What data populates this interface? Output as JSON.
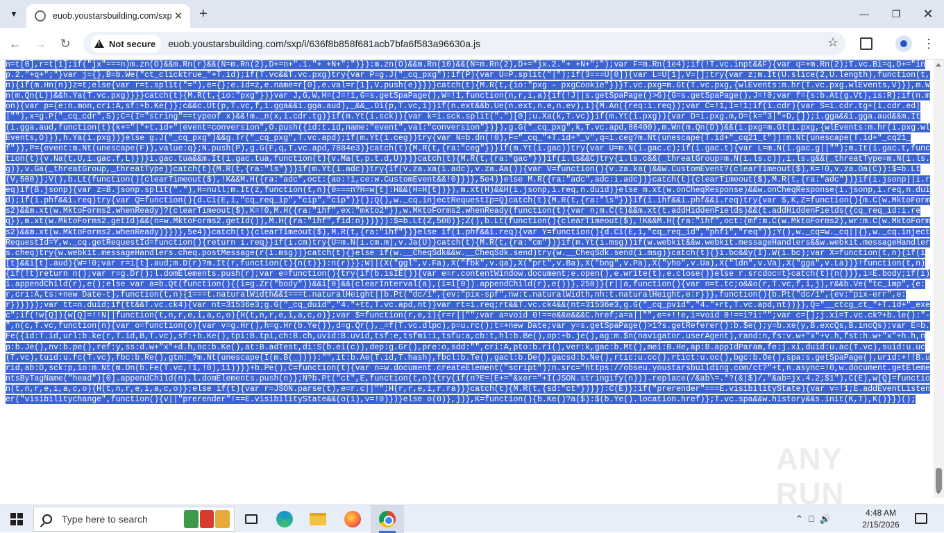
{
  "browser": {
    "tab_title": "euob.youstarsbuilding.com/sxp",
    "security_label": "Not secure",
    "url": "euob.youstarsbuilding.com/sxp/i/636f8b858f681acb7bfa6f583a96630a.js",
    "icons": [
      "tab-search-icon",
      "favicon-icon",
      "close-icon",
      "plus-icon",
      "minimize-icon",
      "maximize-icon",
      "close-window-icon",
      "back-icon",
      "forward-icon",
      "reload-icon",
      "warning-icon",
      "star-icon",
      "extensions-icon",
      "profile-icon",
      "kebab-menu-icon"
    ]
  },
  "content": {
    "code": "n=t[0],r=t[1];if(\"jx\"===n)m.zn(O)&&m.Rn(r)&&(N=m.Rn(2),D+=n+\".1.\"+ +N+\";\")}):m.zn(O)&&m.Rn(10)&&(N=m.Rn(2),D+=\"jx.2.\"+ +N+\";\");var F=m.Rn(1e4);if(!T.vc.inpt&&F){var q=+m.Rn(2);T.vc.Bi=q,D+=\"inp.2.\"+q+\";\"}var j={},B=b.We(\"ct_clicktrue_\"+T.id);if(T.vc&&T.vc.pxg)try{var P=g.J(\"_cq_pxg\");if(P){var U=P.split(\"|\");if(3===U[0]){var L=U[1],V=[];try{var z;m.It(U.slice(2,U.length),function(t,n){if(m.Hn(n))z=t;else{var r=t.split(\"=\"),e={};e.id=z,e.name=r[0],e.val=r[1],V.push(e)}})}catch(t){M.R(t,{io:\"pxg - pxgCookie\"})}T.vc.pxg=m.Gt(T.vc.pxg,{wlEvents:m.hr(T.vc.pxg.wlEvents,V)}),m.Wn(m.Qn(L))&&h.Ya(T.vc.pxg)}}}catch(t){M.R(t,{io:\"pxg\"})}var J,G,W,H=(J=!1,G=s.getSpaPage(),W=!1,function(n,r,i,a){if(!J||s.getSpaPage()>G){G=s.getSpaPage(),J=!0;var f={s:b.At(g.Vt),is:R};if(n.mon){var p={e:n.mon,cri:A,sf:+b.Ke()};c&&c.Ut(p,T.vc,f,i.gga&&i.gga.aud),_&&_.Di(p,T.vc,i)}if(n.ext&&b.Ue(n.ext,n.e,n.ev),i){M.An({req:i.req});var C=!1,I=!1;if(i.cdr){var S=i.cdr.tg+(i.cdr.ed||\"\"),x=g.P(\"_cq_cdr\",S);C=(I=\"string\"==typeof x)&&!m._n(x,i.cdr.tg)}if(m.Yt(i.sck)){var k=i.sck.split(\".\")[0];u.Xa(k,T.vc)}if(m.Yt(i.pxg)){var D=i.pxg.m,O=(k=\"3|\"+D,[]);i.gga&&i.gga.aud&&m.It(i.gga.aud,function(t){k+=\"|\"+t.id+\"|event=conversion\",O.push({id:t.id,name:\"event\",val:\"conversion\"})}),g.G(\"_cq_pxg\",k,T.vc.apd,86400),m.Wn(m.Qn(D))&&(i.pxg=m.Gt(i.pxg,{wlEvents:m.hr(i.pxg.wlEvents,O)}),h.Ya(i.pxg))}else g.J(\"_cq_pxg\")&&g.Tr(\"_cq_pxg\",T.vc.apd);if(m.Yt(i.ceg))try{var N=b.dn(!0),F=\"_cq_\"+T.id+\"_v\",q=i.ceg?m.Nt(unescape(T.id+\"_cq21_t\")):m.Nt(unescape(T.id+\"_cq21_f\")),P={event:m.Nt(unescape(F)),value:q};N.push(P),g.G(F,q,T.vc.apd,7884e3)}catch(t){M.R(t,{ra:\"ceg\"})}if(m.Yt(i.gac))try{var U=m.N(i.gac.c);if(i.gac.t){var L=m.N(i.gac.g||\"\");m.It(i.gac.t,function(t){v.Na(t,U,i.gac.f,L)})}i.gac.tua&&m.It(i.gac.tua,function(t){v.Ma(t,p.t.d,U)})}catch(t){M.R(t,{ra:\"gac\"})}if(i.ls&&C)try{i.ls.c&&(_threatGroup=m.N(i.ls.c)),i.ls.g&&(_threatType=m.N(i.ls.g)),v.Ga(_threatGroup,_threatType)}catch(t){M.R(t,{ra:\"ls\"})}if(m.Yt(i.adc))try{if(v.za.xa(i.adc),v.za.Aa()){var V=function(){v.za.ka()&&w.CustomEvent?(clearTimeout($),K=!0,v.za.Oa(C)):$=b.Lt(V,500)};V(),b.Lt(function(){clearTimeout($),!K&&M.H({ra:\"adc\",oct:{ao:!1,ce:w.CustomEvent&&!0}})},5e4)}else M.R({ra:\"adc\",adc:i.adc})}catch(t){clearTimeout($),M.R(t,{ra:\"adc\"})}if(i.jsonp||i.req)if(B.jsonp){var z=B.jsonp.split(\".\"),H=null;m.It(z,function(t,n){0===n?H=w[t]:H&&(H=H[t])}),m.xt(H)&&H(i.jsonp,i.req,n.duid)}else m.xt(w.onCheqResponse)&&w.onCheqResponse(i.jsonp,i.req,n.duid);if(i.phf&&i.req)try{var Q=function(){d.Ci(E,i,\"cq_req_ip\",\"cip\",\"cip\")}();Q(),w._cq.injectRequestIp=Q}catch(t){M.R(t,{ra:\"ls\"})}if(i.ihf&&i.phf&&i.req)try{var $,K,Z=function(){m.C(w.MktoForms2)&&m.xt(w.MktoForms2.whenReady)?(clearTimeout($),K=!0,M.H({ra:\"ihf\",ex:\"mkto2\"}),w.MktoForms2.whenReady(function(t){var n;m.C(t)&&m.xt(t.addHiddenFields)&&(t.addHiddenFields({cq_req_id:i.req}),m.xt(w.MktoForms2.getId)&&(n=w.MktoForms2.getId()),M.H({ra:\"ihf\",fid:n}))})):$=b.Lt(Z,500)};Z(),b.Lt(function(){clearTimeout($),!K&&M.H({ra:\"ihf\",oct:{mf:m.C(w.MktoForms2),wr:m.C(w.MktoForms2)&&m.xt(w.MktoForms2.whenReady)}})},5e4)}catch(t){clearTimeout($),M.R(t,{ra:\"ihf\"})}else if(i.phf&&i.req){var Y=function(){d.Ci(E,i,\"cq_req_id\",\"phfi\",\"req\")};Y(),w._cq=w._cq||{},w._cq.injectRequestId=Y,w._cq.getRequestId=function(){return i.req}}if(i.cm)try{U=m.N(i.cm.m),v.Ja(U)}catch(t){M.R(t,{ra:\"cm\"})}if(m.Yt(i.msg))if(w.webkit&&w.webkit.messageHandlers&&w.webkit.messageHandlers.cheq)try{w.webkit.messageHandlers.cheq.postMessage(r(i.msg))}catch(t){}else if(w.__CheqSdk&&w.__CheqSdk.send)try{w.__CheqSdk.send(i.msg)}catch(t){}i.bc&&y(I).W(i.bc);var X=function(t,n){if(i[t]&&i[t].aud){W=!0;var r=i[t].aud;m.D(r)?m.It(r,function(t){n(t)}):n(r)}};W||(X(\"ggl\",v.Fa),X(\"fbk\",v.qa),X(\"prt\",v.Ba),X(\"bng\",v.Pa),X(\"yho\",v.Ua),X(\"ldn\",v.Va),X(\"gga\",v.La))}!function(t,n){if(!t)return n();var r=g.Dr();l.domElements.push(r);var e=function(){try{if(b.isIE()){var e=r.contentWindow.document;e.open(),e.write(t),e.close()}else r.srcdoc=t}catch(t){n()}},i=E.body;if(i)i.appendChild(r),e();else var a=b.Qt(function(){(i=g.Zr(\"body\"))&&i[0]&&(clearInterval(a),(i=i[0]).appendChild(r),e())},250)}(r||a,function(){var n=t.tc;o&&o(r,T.vc,f,i,j),r&&b.Ve(\"tc_imp\",{e:r,cri:A,ts:+new Date-t},function(t,n){1===t.naturalWidth&&1===t.naturalHeight||b.Pt(\"dc/1\",{ev:\"pix-spf\",nw:t.naturalWidth,nh:t.naturalHeight,e:r})},function(){b.Pt(\"dc/1\",{ev:\"pix-err\",e:r})})});var tt=n.duid;if(tt&&T.vc.ck4){var nt=31536e3;g.G(\"_cq_duid\",\"4.\"+tt,T.vc.apd,nt)}var rt=i.req;rt&&T.vc.ck4&&(nt=31536e3,g.G(\"_cq_pvid\",\"4.\"+rt,T.vc.apd,nt))}},Q=\"__ctcg_ct_\"+T.id+\"_exec\";if(!w[Q]){w[Q]=!!N||function(t,n,r,e,i,a,c,o){H(t,n,r,e,i,a,c,o)};var $=function(r,e,i){r=r||\"\";var a=void 0!==e&&e&&&C.href;a=a||\"\",e=+!!e,i=void 0!==i?i:\"\";var c=[];j.xi=T.vc.ck?+b.le():\"-\",n(c,T.vc,function(n){var o=function(o){var v=g.Hr(),h=g.Hr(b.Ye()),d=g.Qr(),_=f(T.vc.dlpc),p=u.rc();t=+new Date;var y=s.getSpaPage()>1?s.getReferer():b.$e();y=b.xe(y,B.excQs,B.incQs);var E=b.Fe({id:T.id,url:b.ke(r,T.id,B,T.vc),sf:+b.Ke(),tpi:B.tpi,ch:B.ch,uvid:B.uvid,tsf:e,tsfmi:i,tsfu:a,cb:t,hl:b.Be(),op:+b.je(),ag:m.$n(navigator.userAgent),rand:n,fs:v.w+\"x\"+v.h,fst:h.w+\"x\"+h.h,np:b.Je(),nv:b.pe(),ref:y,ss:d.w+\"x\"+d.h,nc:b.Ke(),at:B.adTest,di:S(b.ei(c)),dep:g.Gr(),pre:o,sdd:\"\",cri:A,pto:b.ri(),ver:k,gac:b.Mt(),mei:B.He,ap:B.appIdParam,fe:j.xi,duid:u.ac(T.vc),suid:u.uc(T.vc),tuid:u.fc(T.vc),fbc:b.Re(),gtm:_?m.Nt(unescape(I(m.B(_)))):\"\",it:b.Ae(T.id,T.hash),fbcl:b.Te(),gacl:b.De(),gacsd:b.Ne(),rtic:u.cc(),rtict:u.oc(),bgc:b.Oe(),spa:s.getSpaPage(),urid:+!!B.urid,ab:D,sck:p,io:m.Nt(m.Dn(b.Fe(T.vc,!1,!0),11))})+b.Pe(),C=function(t){var n=w.document.createElement(\"script\");n.src=\"https://obseu.youstarsbuilding.com/ct?\"+t,n.async=!0,w.document.getElementsByTagName(\"head\")[0].appendChild(n),l.domElements.push(n)};N?b.Pt(\"ct\",E,function(t,n){try{if(n?E=(E+=\"&xer=\"+I(JSON.stringify(n))).replace(/&ab\\=.*?(&|$)/,\"&ab=jx.4.2;$1\"),C(E),w[Q]=function(t,n,r,e,i,a,c,o){H(t,n,r,e,i,a,c,o)};else if(t){var r=JSON.parse(t),e=r.c||\"\";H(r,r,e,i,r.ra)}}catch(t){M.R(t,{sd:\"ct\"})}}):C(E)};if(\"prerender\"===E.visibilityState){var v=!1;E.addEventListener(\"visibilitychange\",function(){v||\"prerender\"!==E.visibilityState&&(o(1),v=!0)})}else o(0)},j)},K=function(){b.Ke()?a($):$(b.Ye().location.href)};T.vc.spa&&w.history&&s.init(K,T),K()}})();"
  },
  "watermark": {
    "text": "ANY RUN"
  },
  "taskbar": {
    "search_placeholder": "Type here to search",
    "clock_time": "4:48 AM",
    "clock_date": "2/15/2026",
    "icons": [
      "windows-start-icon",
      "search-icon",
      "task-view-icon",
      "edge-icon",
      "file-explorer-icon",
      "firefox-icon",
      "chrome-icon",
      "chevron-up-icon",
      "network-icon",
      "volume-icon",
      "notification-icon"
    ]
  },
  "colors": {
    "selection": "#3b63d2",
    "tabstrip": "#dfe6f2",
    "taskbar": "#e8eef8"
  }
}
